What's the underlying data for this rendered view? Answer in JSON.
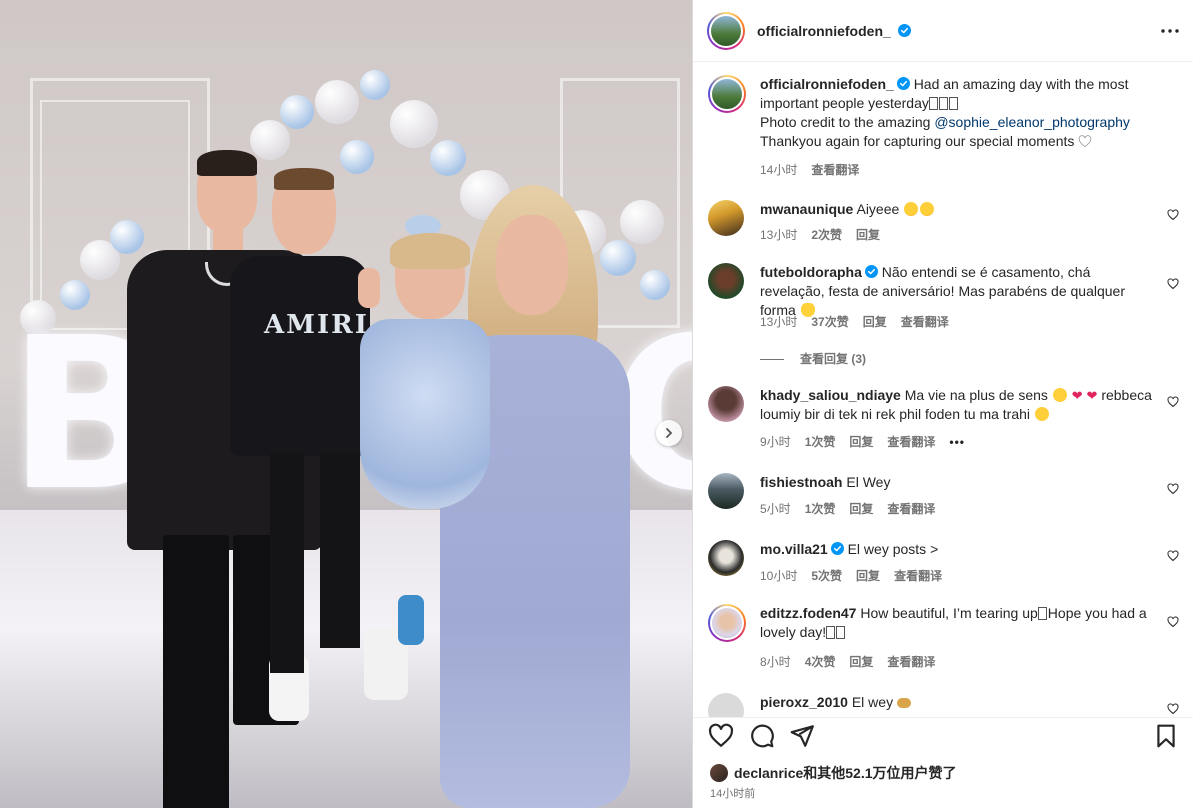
{
  "post": {
    "username": "officialronniefoden_",
    "caption": {
      "line1": "Had an amazing day with the most important people yesterday",
      "line2_prefix": "Photo credit to the amazing ",
      "mention": "@sophie_eleanor_photography",
      "line3": "Thankyou again for capturing our special moments"
    },
    "time": "14小时",
    "translate": "查看翻译"
  },
  "comments": [
    {
      "username": "mwanaunique",
      "text": "Aiyeee",
      "time": "13小时",
      "likes": "2次赞",
      "reply": "回复",
      "translate": "",
      "verified": false
    },
    {
      "username": "futeboldorapha",
      "text": "Não entendi se é casamento, chá revelação, festa de aniversário! Mas parabéns de qualquer forma",
      "time": "13小时",
      "likes": "37次赞",
      "reply": "回复",
      "translate": "查看翻译",
      "verified": true
    },
    {
      "username": "khady_saliou_ndiaye",
      "text": "Ma vie na plus de sens",
      "text2": "rebbeca loumiy bir di tek ni rek phil foden tu ma trahi",
      "time": "9小时",
      "likes": "1次赞",
      "reply": "回复",
      "translate": "查看翻译",
      "verified": false
    },
    {
      "username": "fishiestnoah",
      "text": "El Wey",
      "time": "5小时",
      "likes": "1次赞",
      "reply": "回复",
      "translate": "查看翻译",
      "verified": false
    },
    {
      "username": "mo.villa21",
      "text": "El wey posts >",
      "time": "10小时",
      "likes": "5次赞",
      "reply": "回复",
      "translate": "查看翻译",
      "verified": true
    },
    {
      "username": "editzz.foden47",
      "text": "How beautiful, I’m tearing up",
      "text2": "Hope you had a lovely day!",
      "time": "8小时",
      "likes": "4次赞",
      "reply": "回复",
      "translate": "查看翻译",
      "verified": false
    },
    {
      "username": "pieroxz_2010",
      "text": "El wey",
      "time": "",
      "likes": "",
      "reply": "",
      "translate": "",
      "verified": false
    }
  ],
  "view_replies": "查看回复 (3)",
  "footer": {
    "likes_text": "declanrice和其他52.1万位用户赞了",
    "time": "14小时前"
  },
  "photo": {
    "letters": [
      "B",
      "O"
    ],
    "shirt_text": "AMIRI"
  },
  "colors": {
    "verified": "#0095f6",
    "link": "#00376b",
    "meta": "#737373",
    "text": "#262626"
  }
}
